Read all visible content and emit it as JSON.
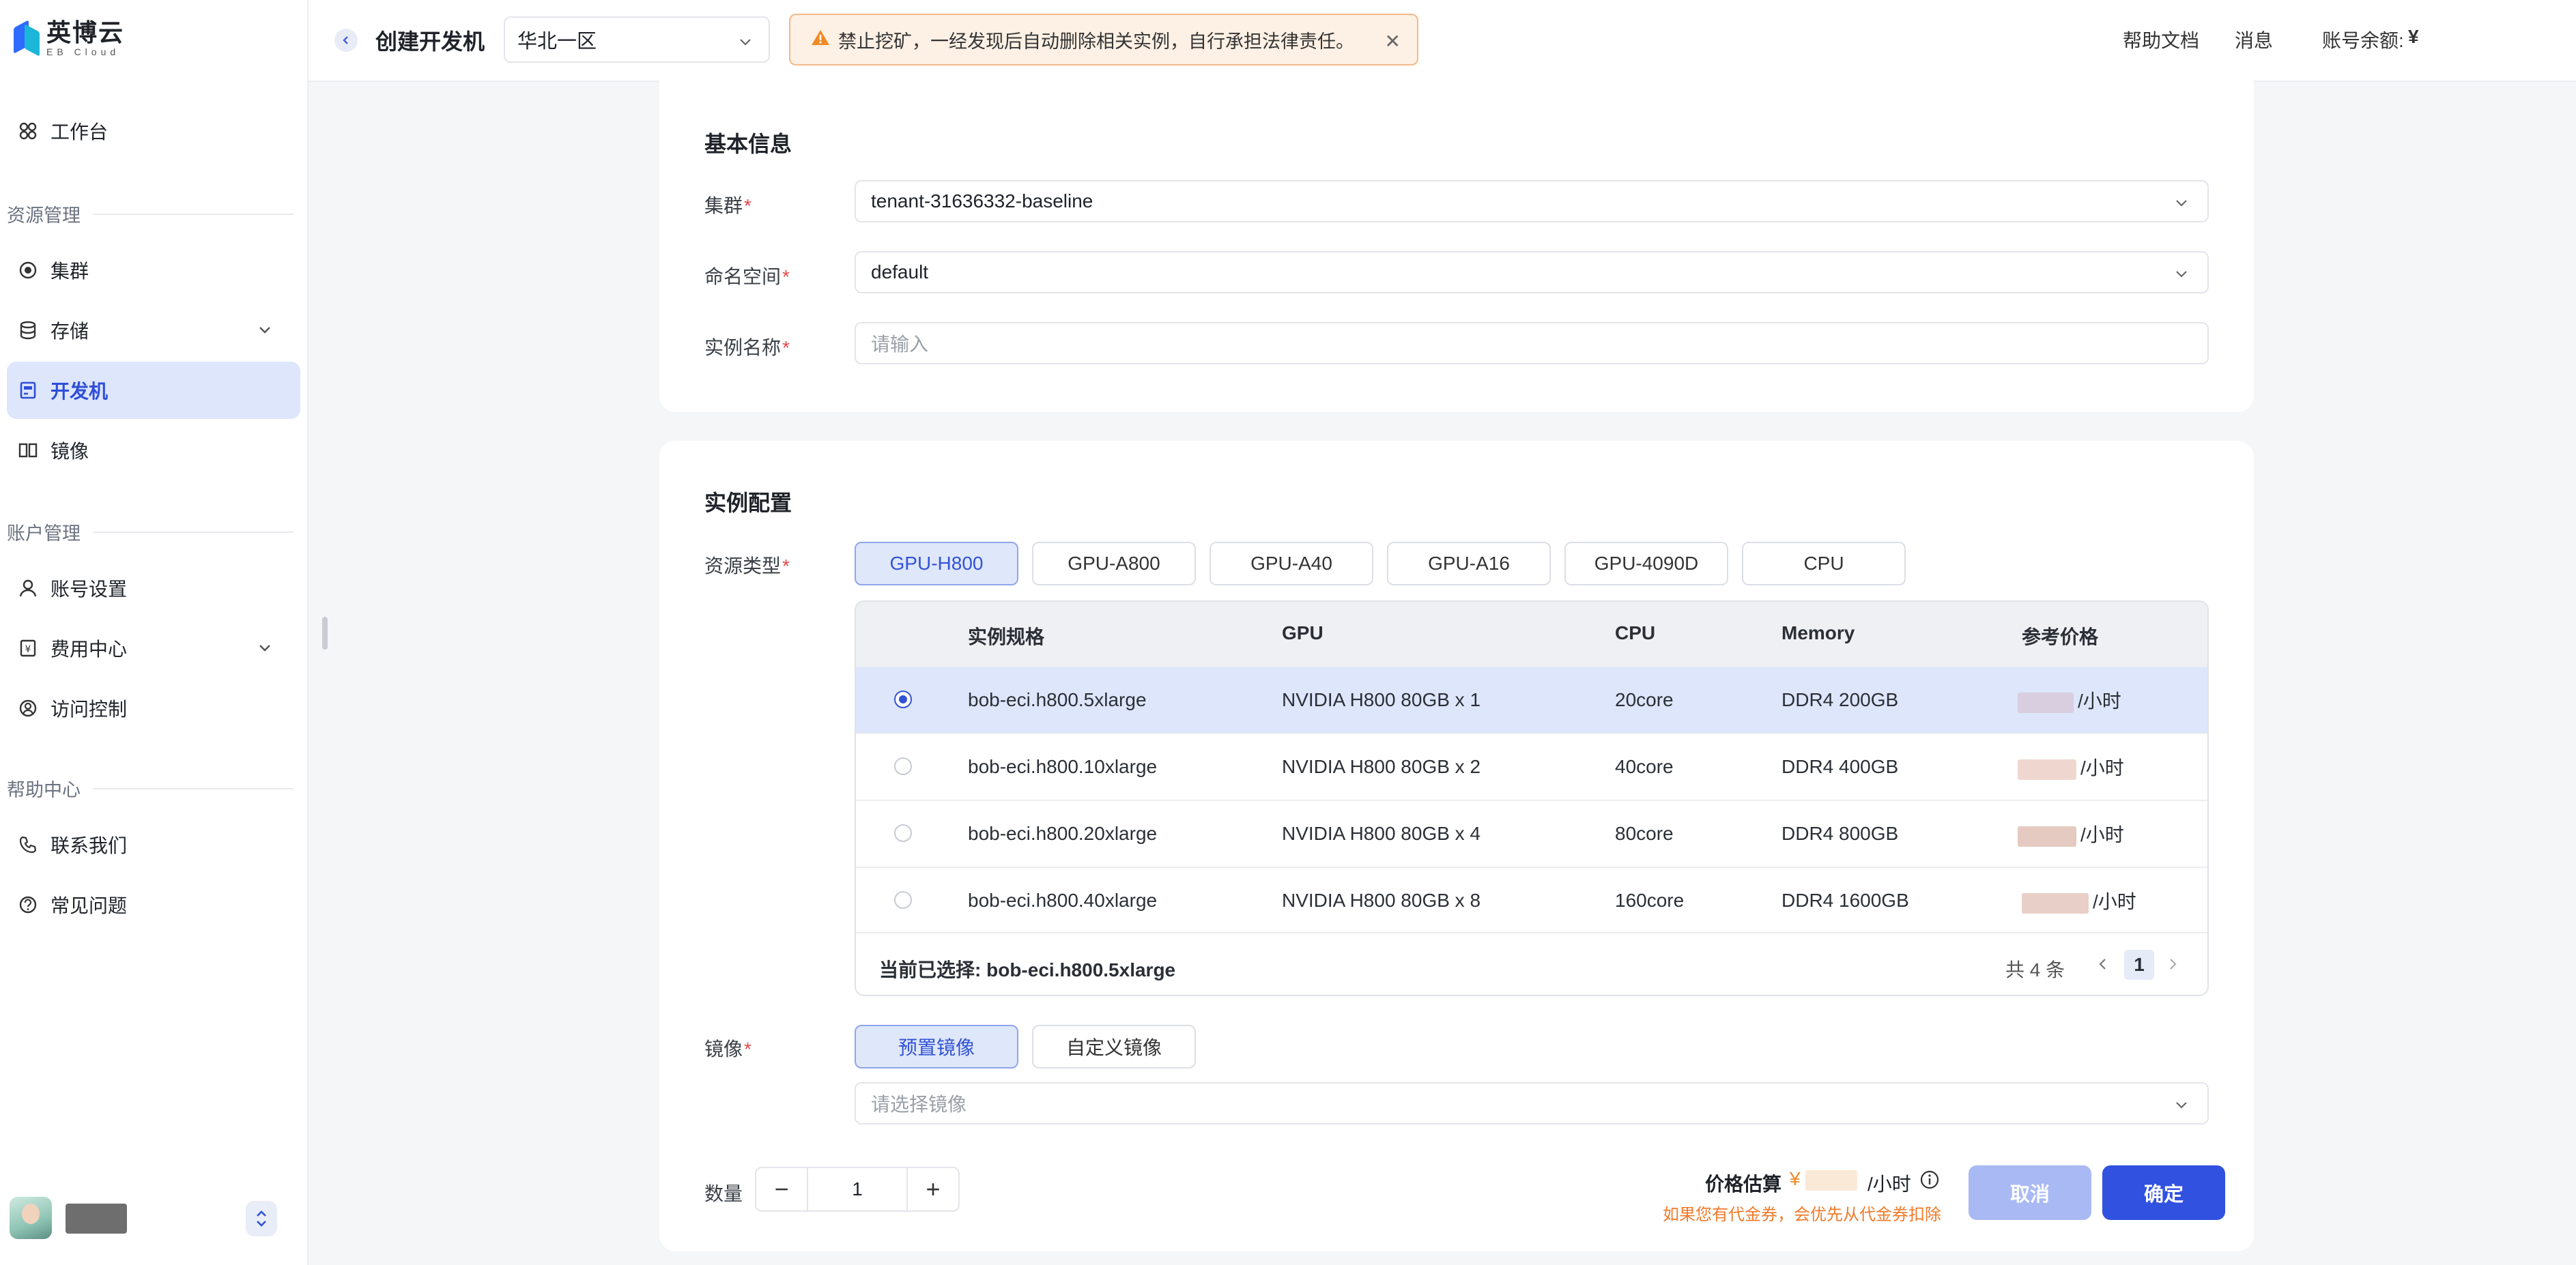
{
  "brand": {
    "name_cn": "英博云",
    "name_en": "EB Cloud"
  },
  "sidebar": {
    "items": [
      {
        "label": "工作台",
        "icon": "dashboard-icon"
      },
      {
        "label": "集群",
        "icon": "cluster-icon"
      },
      {
        "label": "存储",
        "icon": "storage-icon"
      },
      {
        "label": "开发机",
        "icon": "devmachine-icon"
      },
      {
        "label": "镜像",
        "icon": "image-icon"
      },
      {
        "label": "账号设置",
        "icon": "user-icon"
      },
      {
        "label": "费用中心",
        "icon": "billing-icon"
      },
      {
        "label": "访问控制",
        "icon": "access-icon"
      },
      {
        "label": "联系我们",
        "icon": "phone-icon"
      },
      {
        "label": "常见问题",
        "icon": "help-icon"
      }
    ],
    "groups": [
      "资源管理",
      "账户管理",
      "帮助中心"
    ],
    "active": "开发机"
  },
  "header": {
    "title": "创建开发机",
    "region": "华北一区",
    "alert": "禁止挖矿，一经发现后自动删除相关实例，自行承担法律责任。",
    "links": {
      "help": "帮助文档",
      "messages": "消息",
      "balance_label": "账号余额:",
      "balance_currency": "¥"
    }
  },
  "basic_info": {
    "title": "基本信息",
    "cluster_label": "集群",
    "cluster_value": "tenant-31636332-baseline",
    "namespace_label": "命名空间",
    "namespace_value": "default",
    "name_label": "实例名称",
    "name_placeholder": "请输入"
  },
  "instance_config": {
    "title": "实例配置",
    "resource_type_label": "资源类型",
    "resource_types": [
      "GPU-H800",
      "GPU-A800",
      "GPU-A40",
      "GPU-A16",
      "GPU-4090D",
      "CPU"
    ],
    "selected_type": "GPU-H800",
    "table": {
      "columns": [
        "实例规格",
        "GPU",
        "CPU",
        "Memory",
        "参考价格"
      ],
      "rows": [
        {
          "spec": "bob-eci.h800.5xlarge",
          "gpu": "NVIDIA H800 80GB x 1",
          "cpu": "20core",
          "memory": "DDR4 200GB",
          "price_unit": "/小时",
          "selected": true
        },
        {
          "spec": "bob-eci.h800.10xlarge",
          "gpu": "NVIDIA H800 80GB x 2",
          "cpu": "40core",
          "memory": "DDR4 400GB",
          "price_unit": "/小时",
          "selected": false
        },
        {
          "spec": "bob-eci.h800.20xlarge",
          "gpu": "NVIDIA H800 80GB x 4",
          "cpu": "80core",
          "memory": "DDR4 800GB",
          "price_unit": "/小时",
          "selected": false
        },
        {
          "spec": "bob-eci.h800.40xlarge",
          "gpu": "NVIDIA H800 80GB x 8",
          "cpu": "160core",
          "memory": "DDR4 1600GB",
          "price_unit": "/小时",
          "selected": false
        }
      ],
      "selected_label": "当前已选择:",
      "selected_value": "bob-eci.h800.5xlarge",
      "total": "共 4 条",
      "page": "1"
    },
    "image_label": "镜像",
    "image_tabs": [
      "预置镜像",
      "自定义镜像"
    ],
    "selected_image_tab": "预置镜像",
    "image_placeholder": "请选择镜像"
  },
  "footer": {
    "quantity_label": "数量",
    "quantity_value": "1",
    "price_label": "价格估算",
    "price_currency": "¥",
    "price_unit": "/小时",
    "price_note": "如果您有代金券，会优先从代金券扣除",
    "cancel": "取消",
    "confirm": "确定"
  },
  "colors": {
    "primary": "#3151e0",
    "active_bg": "#dde6fb",
    "warning": "#f08a24",
    "required": "#e5484d"
  }
}
